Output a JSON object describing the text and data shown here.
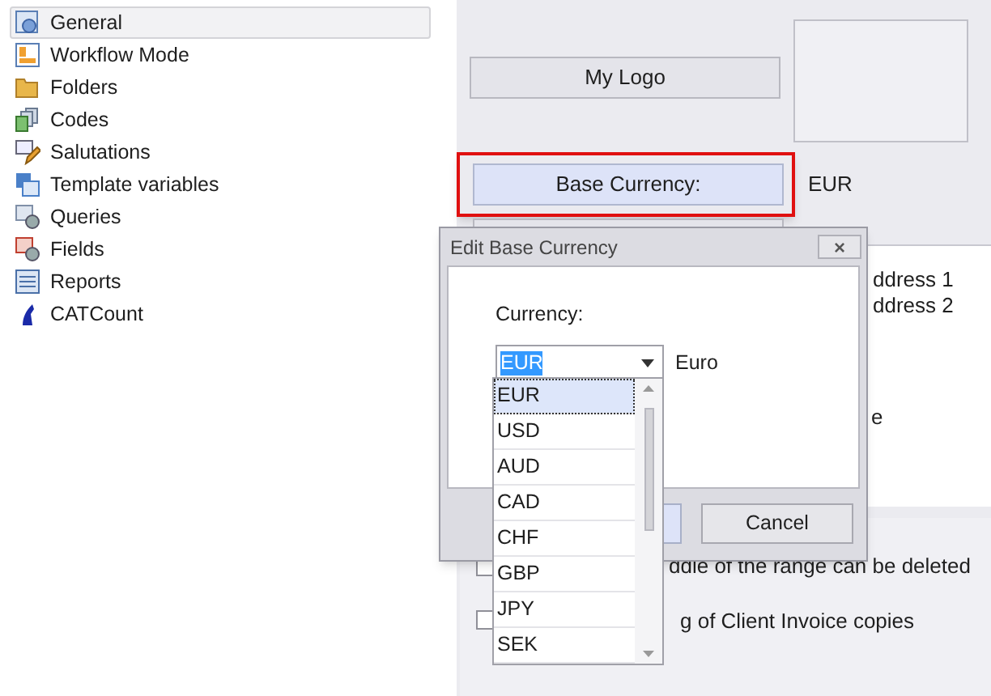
{
  "sidebar": {
    "items": [
      {
        "label": "General",
        "selected": true
      },
      {
        "label": "Workflow Mode",
        "selected": false
      },
      {
        "label": "Folders",
        "selected": false
      },
      {
        "label": "Codes",
        "selected": false
      },
      {
        "label": "Salutations",
        "selected": false
      },
      {
        "label": "Template variables",
        "selected": false
      },
      {
        "label": "Queries",
        "selected": false
      },
      {
        "label": "Fields",
        "selected": false
      },
      {
        "label": "Reports",
        "selected": false
      },
      {
        "label": "CATCount",
        "selected": false
      }
    ]
  },
  "settings": {
    "logo_button": "My Logo",
    "base_currency_button": "Base Currency:",
    "base_currency_value": "EUR",
    "base_currency_highlighted": true,
    "address_lines": [
      "ddress 1",
      "ddress 2"
    ],
    "partial_text": "e",
    "checkboxes": [
      {
        "label": "ddle of the range can be deleted",
        "checked": false
      },
      {
        "label": "g of Client Invoice copies",
        "checked": false
      }
    ]
  },
  "dialog": {
    "title": "Edit Base Currency",
    "close": "×",
    "currency_label": "Currency:",
    "currency_value": "EUR",
    "currency_name": "Euro",
    "cancel": "Cancel",
    "options": [
      {
        "label": "EUR",
        "selected": true
      },
      {
        "label": "USD",
        "selected": false
      },
      {
        "label": "AUD",
        "selected": false
      },
      {
        "label": "CAD",
        "selected": false
      },
      {
        "label": "CHF",
        "selected": false
      },
      {
        "label": "GBP",
        "selected": false
      },
      {
        "label": "JPY",
        "selected": false
      },
      {
        "label": "SEK",
        "selected": false
      }
    ]
  }
}
